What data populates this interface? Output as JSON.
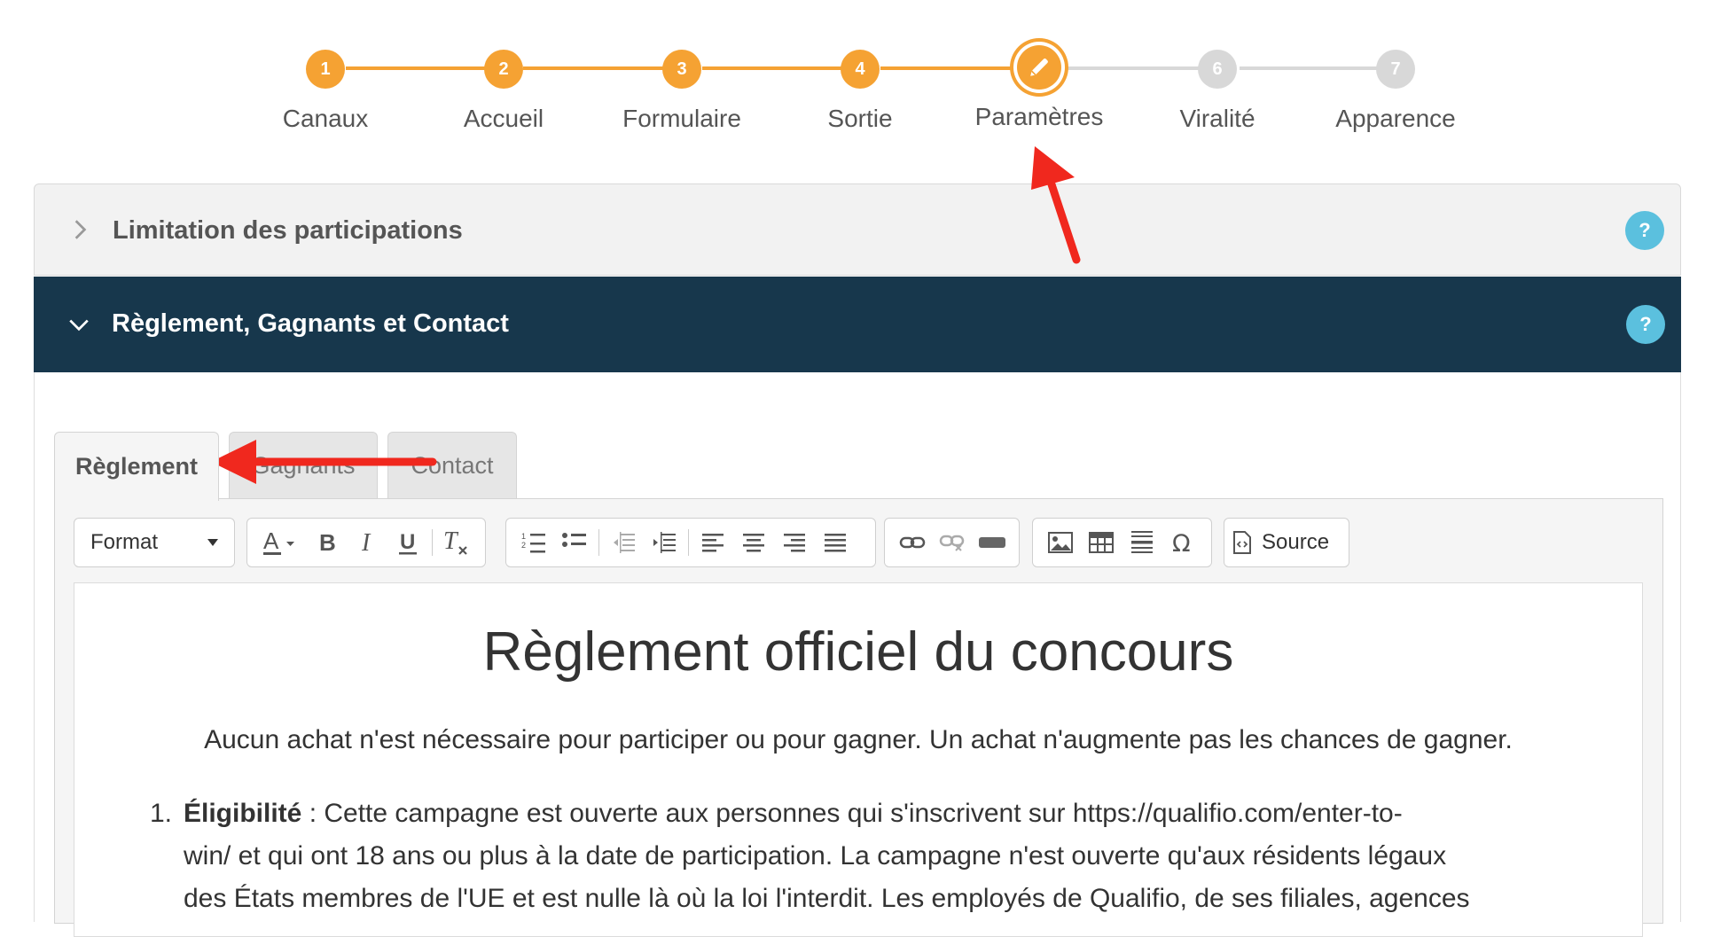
{
  "stepper": {
    "steps": [
      {
        "number": "1",
        "label": "Canaux",
        "state": "done"
      },
      {
        "number": "2",
        "label": "Accueil",
        "state": "done"
      },
      {
        "number": "3",
        "label": "Formulaire",
        "state": "done"
      },
      {
        "number": "4",
        "label": "Sortie",
        "state": "done"
      },
      {
        "number": "",
        "label": "Paramètres",
        "state": "active",
        "icon": "pencil-icon"
      },
      {
        "number": "6",
        "label": "Viralité",
        "state": "todo"
      },
      {
        "number": "7",
        "label": "Apparence",
        "state": "todo"
      }
    ]
  },
  "panels": {
    "limitation": {
      "title": "Limitation des participations",
      "help": "?"
    },
    "reglement": {
      "title": "Règlement, Gagnants et Contact",
      "help": "?"
    }
  },
  "tabs": [
    "Règlement",
    "Gagnants",
    "Contact"
  ],
  "toolbar": {
    "format_label": "Format",
    "source_label": "Source"
  },
  "document": {
    "title": "Règlement officiel du concours",
    "intro": "Aucun achat n'est nécessaire pour participer ou pour gagner. Un achat n'augmente pas les chances de gagner.",
    "item1": {
      "number": "1.",
      "heading": "Éligibilité",
      "text_line1": " : Cette campagne est ouverte aux personnes qui s'inscrivent sur https://qualifio.com/enter-to-",
      "text_line2": "win/ et qui ont 18 ans ou plus à la date de participation. La campagne n'est ouverte qu'aux résidents légaux",
      "text_line3": "des États membres de l'UE et est nulle là où la loi l'interdit. Les employés de Qualifio, de ses filiales, agences"
    }
  },
  "colors": {
    "accent_orange": "#f5a233",
    "inactive_grey": "#d8d8d8",
    "header_dark": "#17374c",
    "help_blue": "#5bc0de",
    "annotation_red": "#f0281e"
  }
}
